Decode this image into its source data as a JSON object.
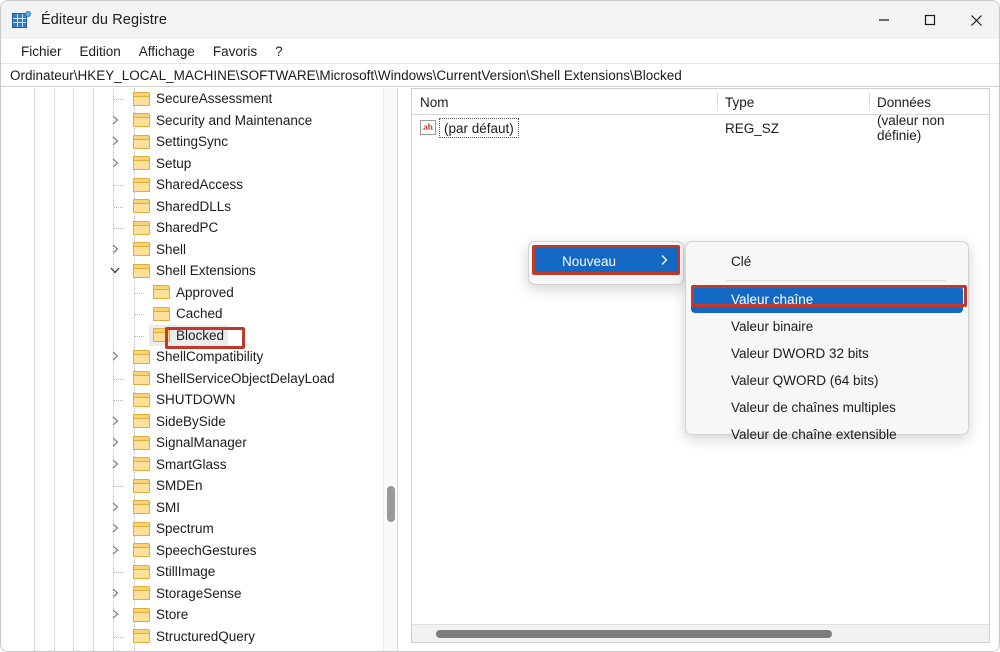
{
  "window": {
    "title": "Éditeur du Registre",
    "icon": "registry-editor-icon",
    "controls": {
      "minimize": "minimize-icon",
      "maximize": "maximize-icon",
      "close": "close-icon"
    }
  },
  "menubar": {
    "items": [
      {
        "label": "Fichier",
        "name": "menu-fichier"
      },
      {
        "label": "Edition",
        "name": "menu-edition"
      },
      {
        "label": "Affichage",
        "name": "menu-affichage"
      },
      {
        "label": "Favoris",
        "name": "menu-favoris"
      },
      {
        "label": "?",
        "name": "menu-help"
      }
    ]
  },
  "address": {
    "path": "Ordinateur\\HKEY_LOCAL_MACHINE\\SOFTWARE\\Microsoft\\Windows\\CurrentVersion\\Shell Extensions\\Blocked"
  },
  "tree": {
    "items": [
      {
        "label": "SecureAssessment",
        "indent": 5,
        "expander": "none",
        "selected": false
      },
      {
        "label": "Security and Maintenance",
        "indent": 5,
        "expander": "collapsed",
        "selected": false
      },
      {
        "label": "SettingSync",
        "indent": 5,
        "expander": "collapsed",
        "selected": false
      },
      {
        "label": "Setup",
        "indent": 5,
        "expander": "collapsed",
        "selected": false
      },
      {
        "label": "SharedAccess",
        "indent": 5,
        "expander": "none",
        "selected": false
      },
      {
        "label": "SharedDLLs",
        "indent": 5,
        "expander": "none",
        "selected": false
      },
      {
        "label": "SharedPC",
        "indent": 5,
        "expander": "none",
        "selected": false
      },
      {
        "label": "Shell",
        "indent": 5,
        "expander": "collapsed",
        "selected": false
      },
      {
        "label": "Shell Extensions",
        "indent": 5,
        "expander": "expanded",
        "selected": false
      },
      {
        "label": "Approved",
        "indent": 6,
        "expander": "none",
        "selected": false
      },
      {
        "label": "Cached",
        "indent": 6,
        "expander": "none",
        "selected": false
      },
      {
        "label": "Blocked",
        "indent": 6,
        "expander": "none",
        "selected": true
      },
      {
        "label": "ShellCompatibility",
        "indent": 5,
        "expander": "collapsed",
        "selected": false
      },
      {
        "label": "ShellServiceObjectDelayLoad",
        "indent": 5,
        "expander": "none",
        "selected": false
      },
      {
        "label": "SHUTDOWN",
        "indent": 5,
        "expander": "none",
        "selected": false
      },
      {
        "label": "SideBySide",
        "indent": 5,
        "expander": "collapsed",
        "selected": false
      },
      {
        "label": "SignalManager",
        "indent": 5,
        "expander": "collapsed",
        "selected": false
      },
      {
        "label": "SmartGlass",
        "indent": 5,
        "expander": "collapsed",
        "selected": false
      },
      {
        "label": "SMDEn",
        "indent": 5,
        "expander": "none",
        "selected": false
      },
      {
        "label": "SMI",
        "indent": 5,
        "expander": "collapsed",
        "selected": false
      },
      {
        "label": "Spectrum",
        "indent": 5,
        "expander": "collapsed",
        "selected": false
      },
      {
        "label": "SpeechGestures",
        "indent": 5,
        "expander": "collapsed",
        "selected": false
      },
      {
        "label": "StillImage",
        "indent": 5,
        "expander": "none",
        "selected": false
      },
      {
        "label": "StorageSense",
        "indent": 5,
        "expander": "collapsed",
        "selected": false
      },
      {
        "label": "Store",
        "indent": 5,
        "expander": "collapsed",
        "selected": false
      },
      {
        "label": "StructuredQuery",
        "indent": 5,
        "expander": "none",
        "selected": false
      }
    ]
  },
  "list": {
    "columns": [
      {
        "label": "Nom",
        "name": "column-nom"
      },
      {
        "label": "Type",
        "name": "column-type"
      },
      {
        "label": "Données",
        "name": "column-donnees"
      }
    ],
    "rows": [
      {
        "name": "(par défaut)",
        "type": "REG_SZ",
        "data": "(valeur non définie)",
        "icon": "ab-string-icon"
      }
    ]
  },
  "context_menu": {
    "parent": {
      "label": "Nouveau",
      "arrow": "chevron-right-icon",
      "highlighted": true
    },
    "submenu": [
      {
        "label": "Clé",
        "selected": false,
        "separator_after": true
      },
      {
        "label": "Valeur chaîne",
        "selected": true,
        "separator_after": false
      },
      {
        "label": "Valeur binaire",
        "selected": false,
        "separator_after": false
      },
      {
        "label": "Valeur DWORD 32 bits",
        "selected": false,
        "separator_after": false
      },
      {
        "label": "Valeur QWORD (64 bits)",
        "selected": false,
        "separator_after": false
      },
      {
        "label": "Valeur de chaînes multiples",
        "selected": false,
        "separator_after": false
      },
      {
        "label": "Valeur de chaîne extensible",
        "selected": false,
        "separator_after": false
      }
    ]
  },
  "colors": {
    "accent": "#1268c3",
    "annotation": "#c0392b",
    "folder": "#ffe09a",
    "titlebar": "#f3f3f3"
  }
}
